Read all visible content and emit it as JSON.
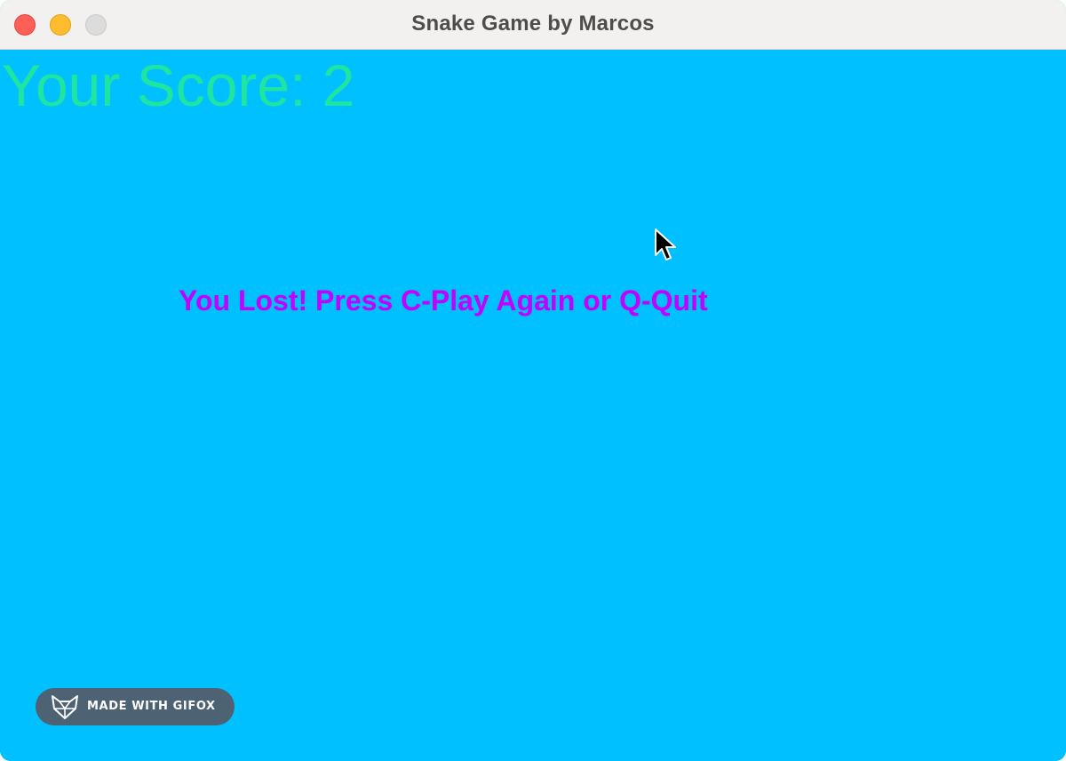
{
  "window": {
    "title": "Snake Game by Marcos"
  },
  "game": {
    "score_text": "Your Score: 2",
    "message": "You Lost! Press C-Play Again or Q-Quit",
    "background_color": "#00c0ff",
    "score_color": "#1ee5a0",
    "message_color": "#c400ff"
  },
  "watermark": {
    "label": "MADE WITH GIFOX",
    "icon": "fox-icon"
  }
}
